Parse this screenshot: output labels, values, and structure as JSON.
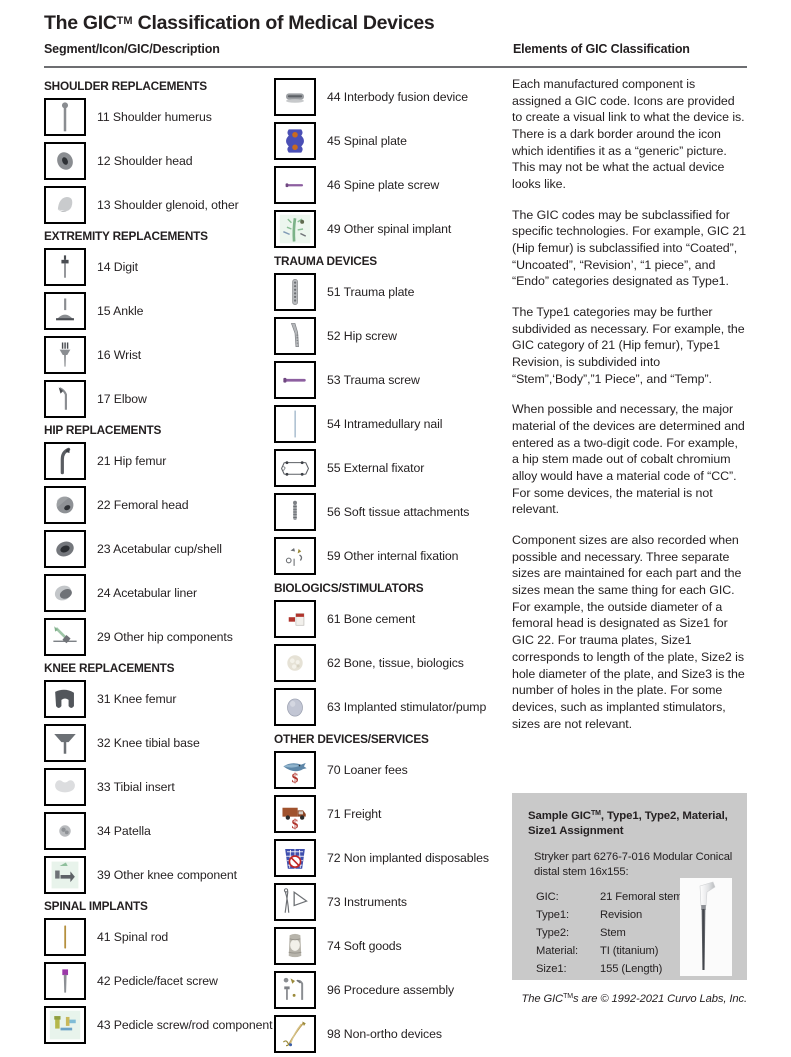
{
  "header": {
    "title_main": "The GIC",
    "title_tm": "TM",
    "title_rest": " Classification of Medical Devices",
    "subhead_left": "Segment/Icon/GIC/Description",
    "subhead_right": "Elements of GIC Classification"
  },
  "columns": [
    {
      "groups": [
        {
          "heading": "SHOULDER REPLACEMENTS",
          "items": [
            {
              "code": "11",
              "label": "11 Shoulder humerus",
              "icon": "shoulder-humerus-icon"
            },
            {
              "code": "12",
              "label": "12 Shoulder head",
              "icon": "shoulder-head-icon"
            },
            {
              "code": "13",
              "label": "13 Shoulder glenoid, other",
              "icon": "shoulder-glenoid-icon"
            }
          ]
        },
        {
          "heading": "EXTREMITY REPLACEMENTS",
          "items": [
            {
              "code": "14",
              "label": "14 Digit",
              "icon": "digit-icon"
            },
            {
              "code": "15",
              "label": "15 Ankle",
              "icon": "ankle-icon"
            },
            {
              "code": "16",
              "label": "16 Wrist",
              "icon": "wrist-icon"
            },
            {
              "code": "17",
              "label": "17 Elbow",
              "icon": "elbow-icon"
            }
          ]
        },
        {
          "heading": "HIP REPLACEMENTS",
          "items": [
            {
              "code": "21",
              "label": "21 Hip femur",
              "icon": "hip-femur-icon"
            },
            {
              "code": "22",
              "label": "22 Femoral head",
              "icon": "femoral-head-icon"
            },
            {
              "code": "23",
              "label": "23 Acetabular cup/shell",
              "icon": "acetabular-cup-icon"
            },
            {
              "code": "24",
              "label": "24 Acetabular liner",
              "icon": "acetabular-liner-icon"
            },
            {
              "code": "29",
              "label": "29 Other hip components",
              "icon": "other-hip-components-icon"
            }
          ]
        },
        {
          "heading": "KNEE REPLACEMENTS",
          "items": [
            {
              "code": "31",
              "label": "31 Knee femur",
              "icon": "knee-femur-icon"
            },
            {
              "code": "32",
              "label": "32 Knee tibial base",
              "icon": "knee-tibial-base-icon"
            },
            {
              "code": "33",
              "label": "33 Tibial insert",
              "icon": "tibial-insert-icon"
            },
            {
              "code": "34",
              "label": "34 Patella",
              "icon": "patella-icon"
            },
            {
              "code": "39",
              "label": "39 Other knee component",
              "icon": "other-knee-component-icon"
            }
          ]
        },
        {
          "heading": "SPINAL IMPLANTS",
          "items": [
            {
              "code": "41",
              "label": "41 Spinal rod",
              "icon": "spinal-rod-icon"
            },
            {
              "code": "42",
              "label": "42 Pedicle/facet screw",
              "icon": "pedicle-facet-screw-icon"
            },
            {
              "code": "43",
              "label": "43 Pedicle screw/rod component",
              "icon": "pedicle-screw-rod-component-icon"
            }
          ]
        }
      ]
    },
    {
      "groups": [
        {
          "heading": "",
          "items": [
            {
              "code": "44",
              "label": "44 Interbody fusion device",
              "icon": "interbody-fusion-device-icon"
            },
            {
              "code": "45",
              "label": "45 Spinal plate",
              "icon": "spinal-plate-icon"
            },
            {
              "code": "46",
              "label": "46 Spine plate screw",
              "icon": "spine-plate-screw-icon"
            },
            {
              "code": "49",
              "label": "49 Other spinal implant",
              "icon": "other-spinal-implant-icon"
            }
          ]
        },
        {
          "heading": "TRAUMA DEVICES",
          "items": [
            {
              "code": "51",
              "label": "51 Trauma plate",
              "icon": "trauma-plate-icon"
            },
            {
              "code": "52",
              "label": "52 Hip screw",
              "icon": "hip-screw-icon"
            },
            {
              "code": "53",
              "label": "53 Trauma screw",
              "icon": "trauma-screw-icon"
            },
            {
              "code": "54",
              "label": "54 Intramedullary nail",
              "icon": "intramedullary-nail-icon"
            },
            {
              "code": "55",
              "label": "55 External fixator",
              "icon": "external-fixator-icon"
            },
            {
              "code": "56",
              "label": "56 Soft tissue attachments",
              "icon": "soft-tissue-attachments-icon"
            },
            {
              "code": "59",
              "label": "59 Other internal fixation",
              "icon": "other-internal-fixation-icon"
            }
          ]
        },
        {
          "heading": "BIOLOGICS/STIMULATORS",
          "items": [
            {
              "code": "61",
              "label": "61 Bone cement",
              "icon": "bone-cement-icon"
            },
            {
              "code": "62",
              "label": "62 Bone, tissue, biologics",
              "icon": "bone-tissue-biologics-icon"
            },
            {
              "code": "63",
              "label": "63 Implanted stimulator/pump",
              "icon": "implanted-stimulator-pump-icon"
            }
          ]
        },
        {
          "heading": "OTHER DEVICES/SERVICES",
          "items": [
            {
              "code": "70",
              "label": "70 Loaner fees",
              "icon": "loaner-fees-icon"
            },
            {
              "code": "71",
              "label": "71 Freight",
              "icon": "freight-truck-icon"
            },
            {
              "code": "72",
              "label": "72 Non implanted disposables",
              "icon": "non-implanted-disposables-icon"
            },
            {
              "code": "73",
              "label": "73 Instruments",
              "icon": "instruments-icon"
            },
            {
              "code": "74",
              "label": "74 Soft goods",
              "icon": "soft-goods-icon"
            },
            {
              "code": "96",
              "label": "96 Procedure assembly",
              "icon": "procedure-assembly-icon"
            },
            {
              "code": "98",
              "label": "98 Non-ortho devices",
              "icon": "non-ortho-devices-icon"
            }
          ]
        }
      ]
    }
  ],
  "elements_text": {
    "p1": "Each manufactured component is assigned a GIC code. Icons are provided to create a visual link to what the device is. There is a dark border around the icon which identifies it as a “generic” picture. This may not be what the actual device looks like.",
    "p2": "The GIC codes may be subclassified for specific technologies. For example, GIC 21 (Hip femur) is subclassified into “Coated”, “Uncoated”, “Revision’, “1 piece”, and “Endo” categories designated as Type1.",
    "p3": "The Type1 categories may be further subdivided as necessary. For example, the GIC category of 21 (Hip femur), Type1 Revision, is subdivided into “Stem”,‘Body”,”1 Piece”, and “Temp”.",
    "p4": "When possible and necessary, the major material of the devices are determined and entered as a two-digit code. For example, a hip stem made out of cobalt chromium alloy would have a material code of “CC”. For some devices, the material is not relevant.",
    "p5": "Component sizes are also recorded when possible and necessary. Three separate sizes are maintained for each part and the sizes mean the same thing for each GIC. For example, the outside diameter of a femoral head is designated as Size1 for GIC 22. For trauma plates, Size1 corresponds to length of the plate, Size2 is hole diameter of the plate, and Size3 is the number of holes in the plate. For some devices, such as implanted stimulators, sizes are not relevant."
  },
  "sample_box": {
    "title_a": "Sample GIC",
    "title_tm": "TM",
    "title_b": ", Type1, Type2, Material, Size1 Assignment",
    "description": "Stryker part 6276-7-016 Modular Conical distal stem 16x155:",
    "rows": [
      {
        "key": "GIC:",
        "value": "21 Femoral stem"
      },
      {
        "key": "Type1:",
        "value": "Revision"
      },
      {
        "key": "Type2:",
        "value": "Stem"
      },
      {
        "key": "Material:",
        "value": "TI (titanium)"
      },
      {
        "key": "Size1:",
        "value": "155 (Length)"
      }
    ],
    "photo_icon": "femoral-stem-photo"
  },
  "footer": {
    "text_a": "The GIC",
    "tm": "TM",
    "text_b": "s are © 1992-2021 Curvo Labs, Inc."
  },
  "colors": {
    "text": "#231f20",
    "rule": "#6d6e71",
    "sample_bg": "#c9c9c9",
    "icon_border": "#000000"
  }
}
